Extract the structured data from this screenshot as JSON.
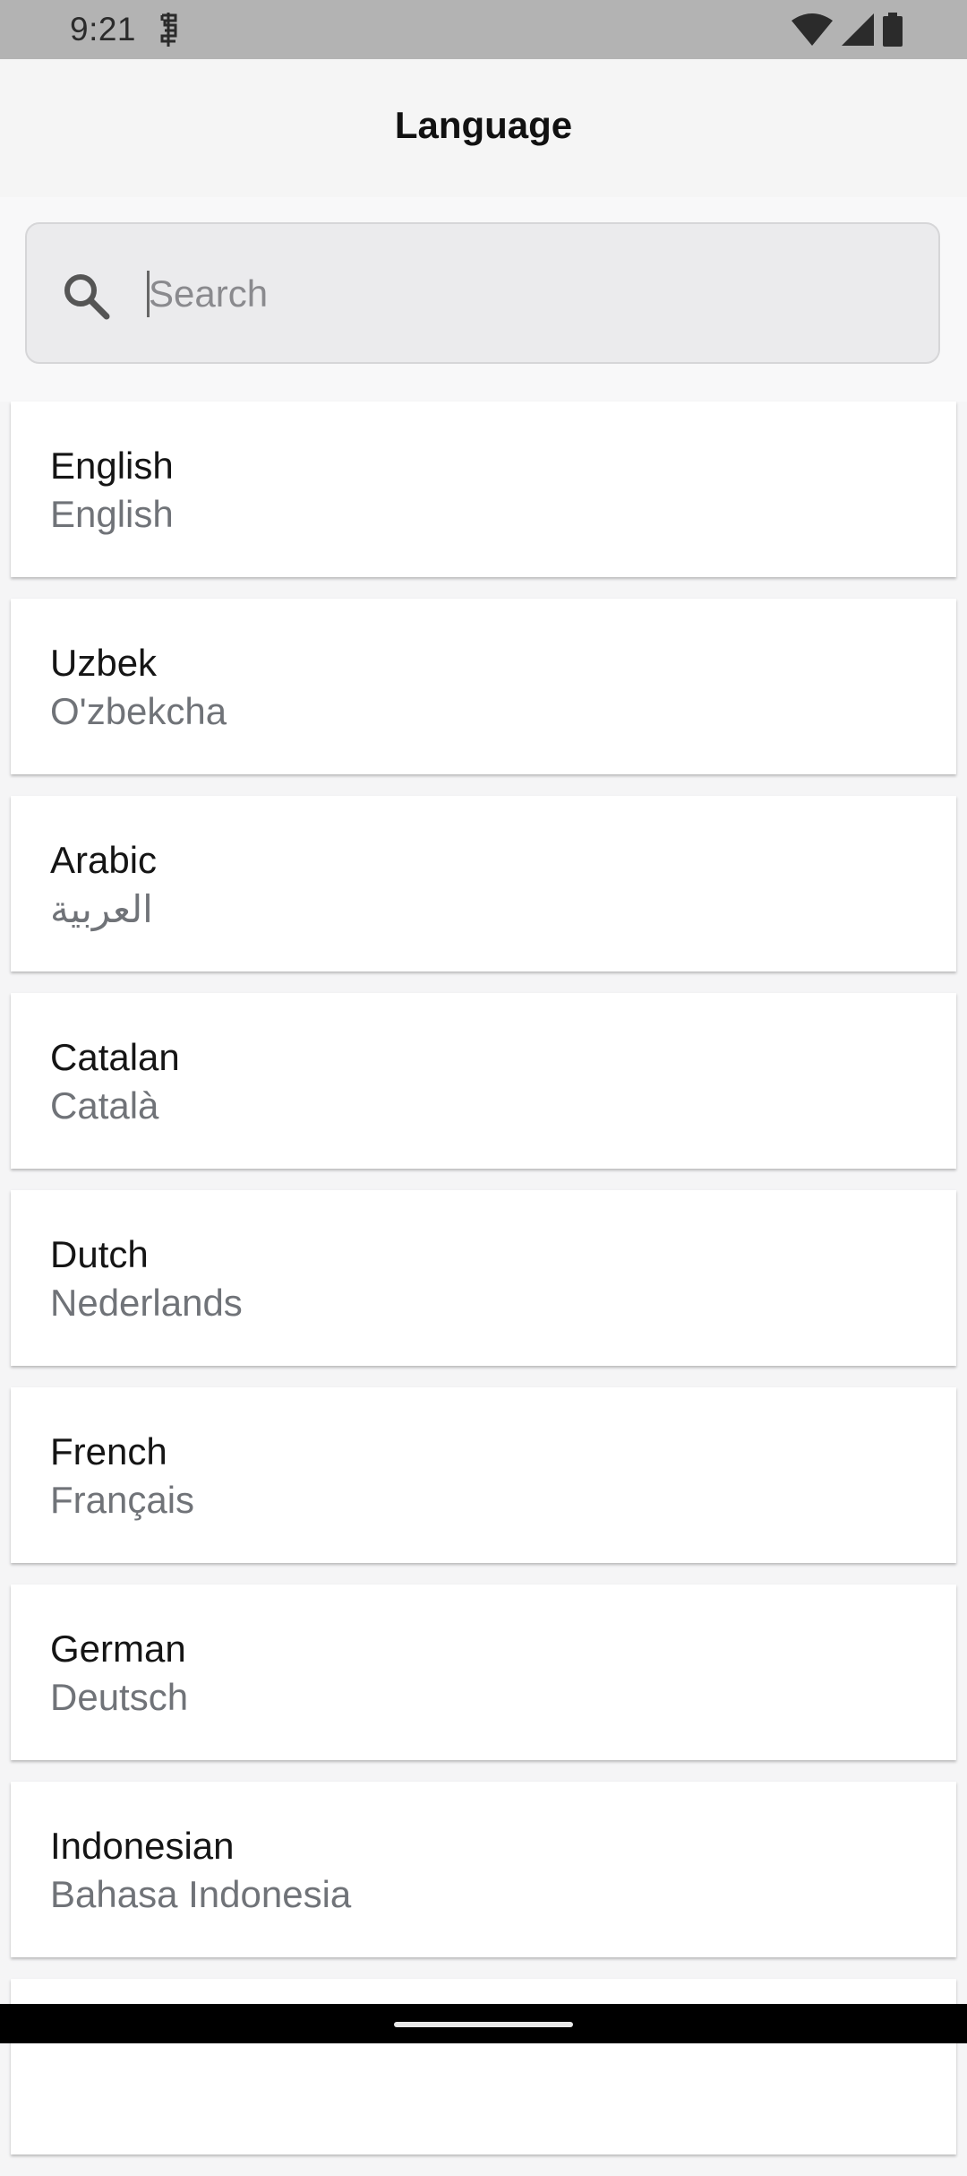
{
  "status_bar": {
    "time": "9:21"
  },
  "header": {
    "title": "Language"
  },
  "search": {
    "placeholder": "Search",
    "value": ""
  },
  "languages": [
    {
      "name": "English",
      "native": "English"
    },
    {
      "name": "Uzbek",
      "native": "O'zbekcha"
    },
    {
      "name": "Arabic",
      "native": "العربية"
    },
    {
      "name": "Catalan",
      "native": "Català"
    },
    {
      "name": "Dutch",
      "native": "Nederlands"
    },
    {
      "name": "French",
      "native": "Français"
    },
    {
      "name": "German",
      "native": "Deutsch"
    },
    {
      "name": "Indonesian",
      "native": "Bahasa Indonesia"
    },
    {
      "name": "",
      "native": ""
    }
  ],
  "colors": {
    "status_bar_bg": "#b3b3b3",
    "header_bg": "#f5f5f5",
    "search_bg": "#ebebed",
    "card_bg": "#ffffff",
    "primary_text": "#151515",
    "secondary_text": "#707378"
  }
}
